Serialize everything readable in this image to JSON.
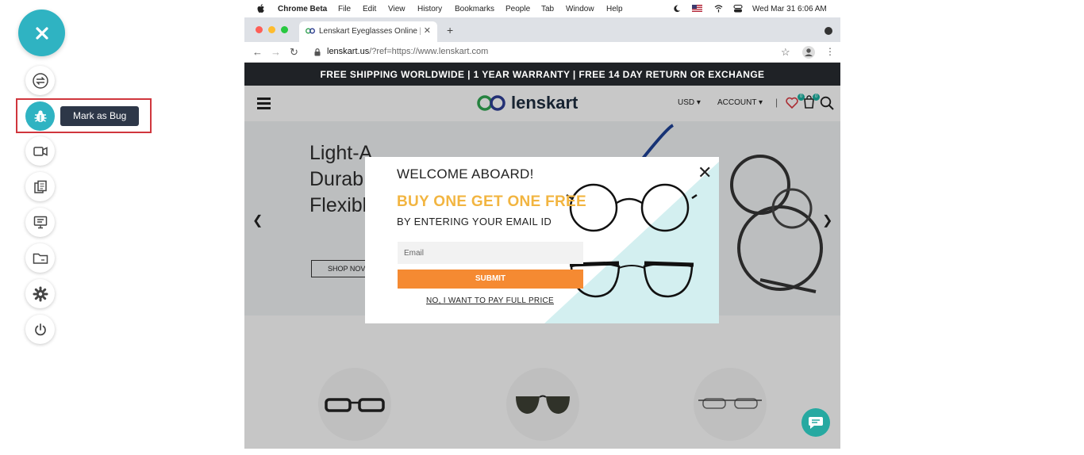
{
  "toolbar": {
    "tooltip": "Mark as Bug",
    "buttons": [
      "close",
      "switch",
      "mark-bug",
      "video",
      "copy",
      "screen",
      "folder",
      "settings",
      "power"
    ]
  },
  "mac_menubar": {
    "app": "Chrome Beta",
    "items": [
      "File",
      "Edit",
      "View",
      "History",
      "Bookmarks",
      "People",
      "Tab",
      "Window",
      "Help"
    ],
    "datetime": "Wed Mar 31  6:06 AM"
  },
  "browser": {
    "tab_title": "Lenskart Eyeglasses Online | P",
    "url_host": "lenskart.us",
    "url_rest": "/?ref=https://www.lenskart.com"
  },
  "site": {
    "announcement": "FREE SHIPPING WORLDWIDE | 1 YEAR WARRANTY | FREE 14 DAY RETURN OR EXCHANGE",
    "logo": "lenskart",
    "currency": "USD",
    "account": "ACCOUNT",
    "wishlist_count": "0",
    "cart_count": "0",
    "hero_lines": [
      "Light-A",
      "Durab",
      "Flexibl"
    ],
    "shop_now": "SHOP NOV"
  },
  "popup": {
    "title": "WELCOME ABOARD!",
    "promo": "BUY ONE GET ONE FREE",
    "subtitle": "BY ENTERING YOUR EMAIL ID",
    "email_placeholder": "Email",
    "submit": "SUBMIT",
    "decline": "NO, I WANT TO PAY FULL PRICE"
  },
  "colors": {
    "accent": "#2fb3c2",
    "highlight": "#d0363d",
    "promo": "#f2b541",
    "submit": "#f58a32"
  }
}
